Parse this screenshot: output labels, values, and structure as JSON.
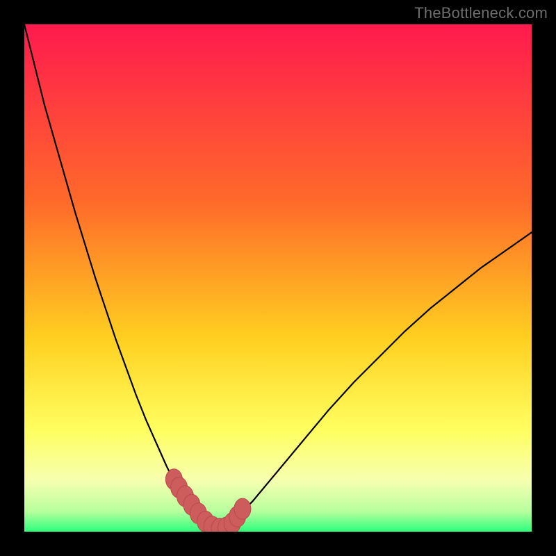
{
  "watermark": "TheBottleneck.com",
  "colors": {
    "top": "#ff1a4e",
    "mid1": "#ff6a2a",
    "mid2": "#ffd020",
    "mid3": "#ffff60",
    "bottom1": "#f6ffb0",
    "bottom2": "#b8ff9e",
    "bottom3": "#2cff7c",
    "frame": "#000000",
    "curve": "#000000",
    "marker_fill": "#cd5c5c",
    "marker_stroke": "#b94a4a"
  },
  "chart_data": {
    "type": "line",
    "title": "",
    "xlabel": "",
    "ylabel": "",
    "xlim": [
      0,
      100
    ],
    "ylim": [
      0,
      100
    ],
    "series": [
      {
        "name": "bottleneck-curve",
        "x": [
          0,
          2,
          4,
          6,
          8,
          10,
          12,
          14,
          16,
          18,
          20,
          22,
          24,
          26,
          28,
          30,
          32,
          34,
          35,
          36,
          37,
          38,
          39,
          40,
          42,
          45,
          50,
          55,
          60,
          65,
          70,
          75,
          80,
          85,
          90,
          95,
          100
        ],
        "y": [
          100,
          92,
          84,
          77,
          70,
          63,
          56.5,
          50,
          44,
          38,
          32.5,
          27,
          22,
          17.5,
          13,
          9,
          5.5,
          2.5,
          1.2,
          0.5,
          0.2,
          0.2,
          0.5,
          1.2,
          3,
          6,
          12,
          18,
          24,
          29.5,
          34.5,
          39.5,
          44,
          48,
          52,
          55.5,
          59
        ]
      }
    ],
    "markers": {
      "name": "highlight-points",
      "x": [
        29.5,
        30.5,
        31.7,
        33.0,
        34.3,
        35.7,
        37.0,
        38.5,
        39.8,
        41.0,
        42.0,
        43.0
      ],
      "y": [
        10.3,
        8.7,
        7.0,
        5.3,
        3.6,
        2.0,
        1.0,
        0.6,
        0.8,
        1.7,
        3.0,
        4.5
      ]
    }
  }
}
